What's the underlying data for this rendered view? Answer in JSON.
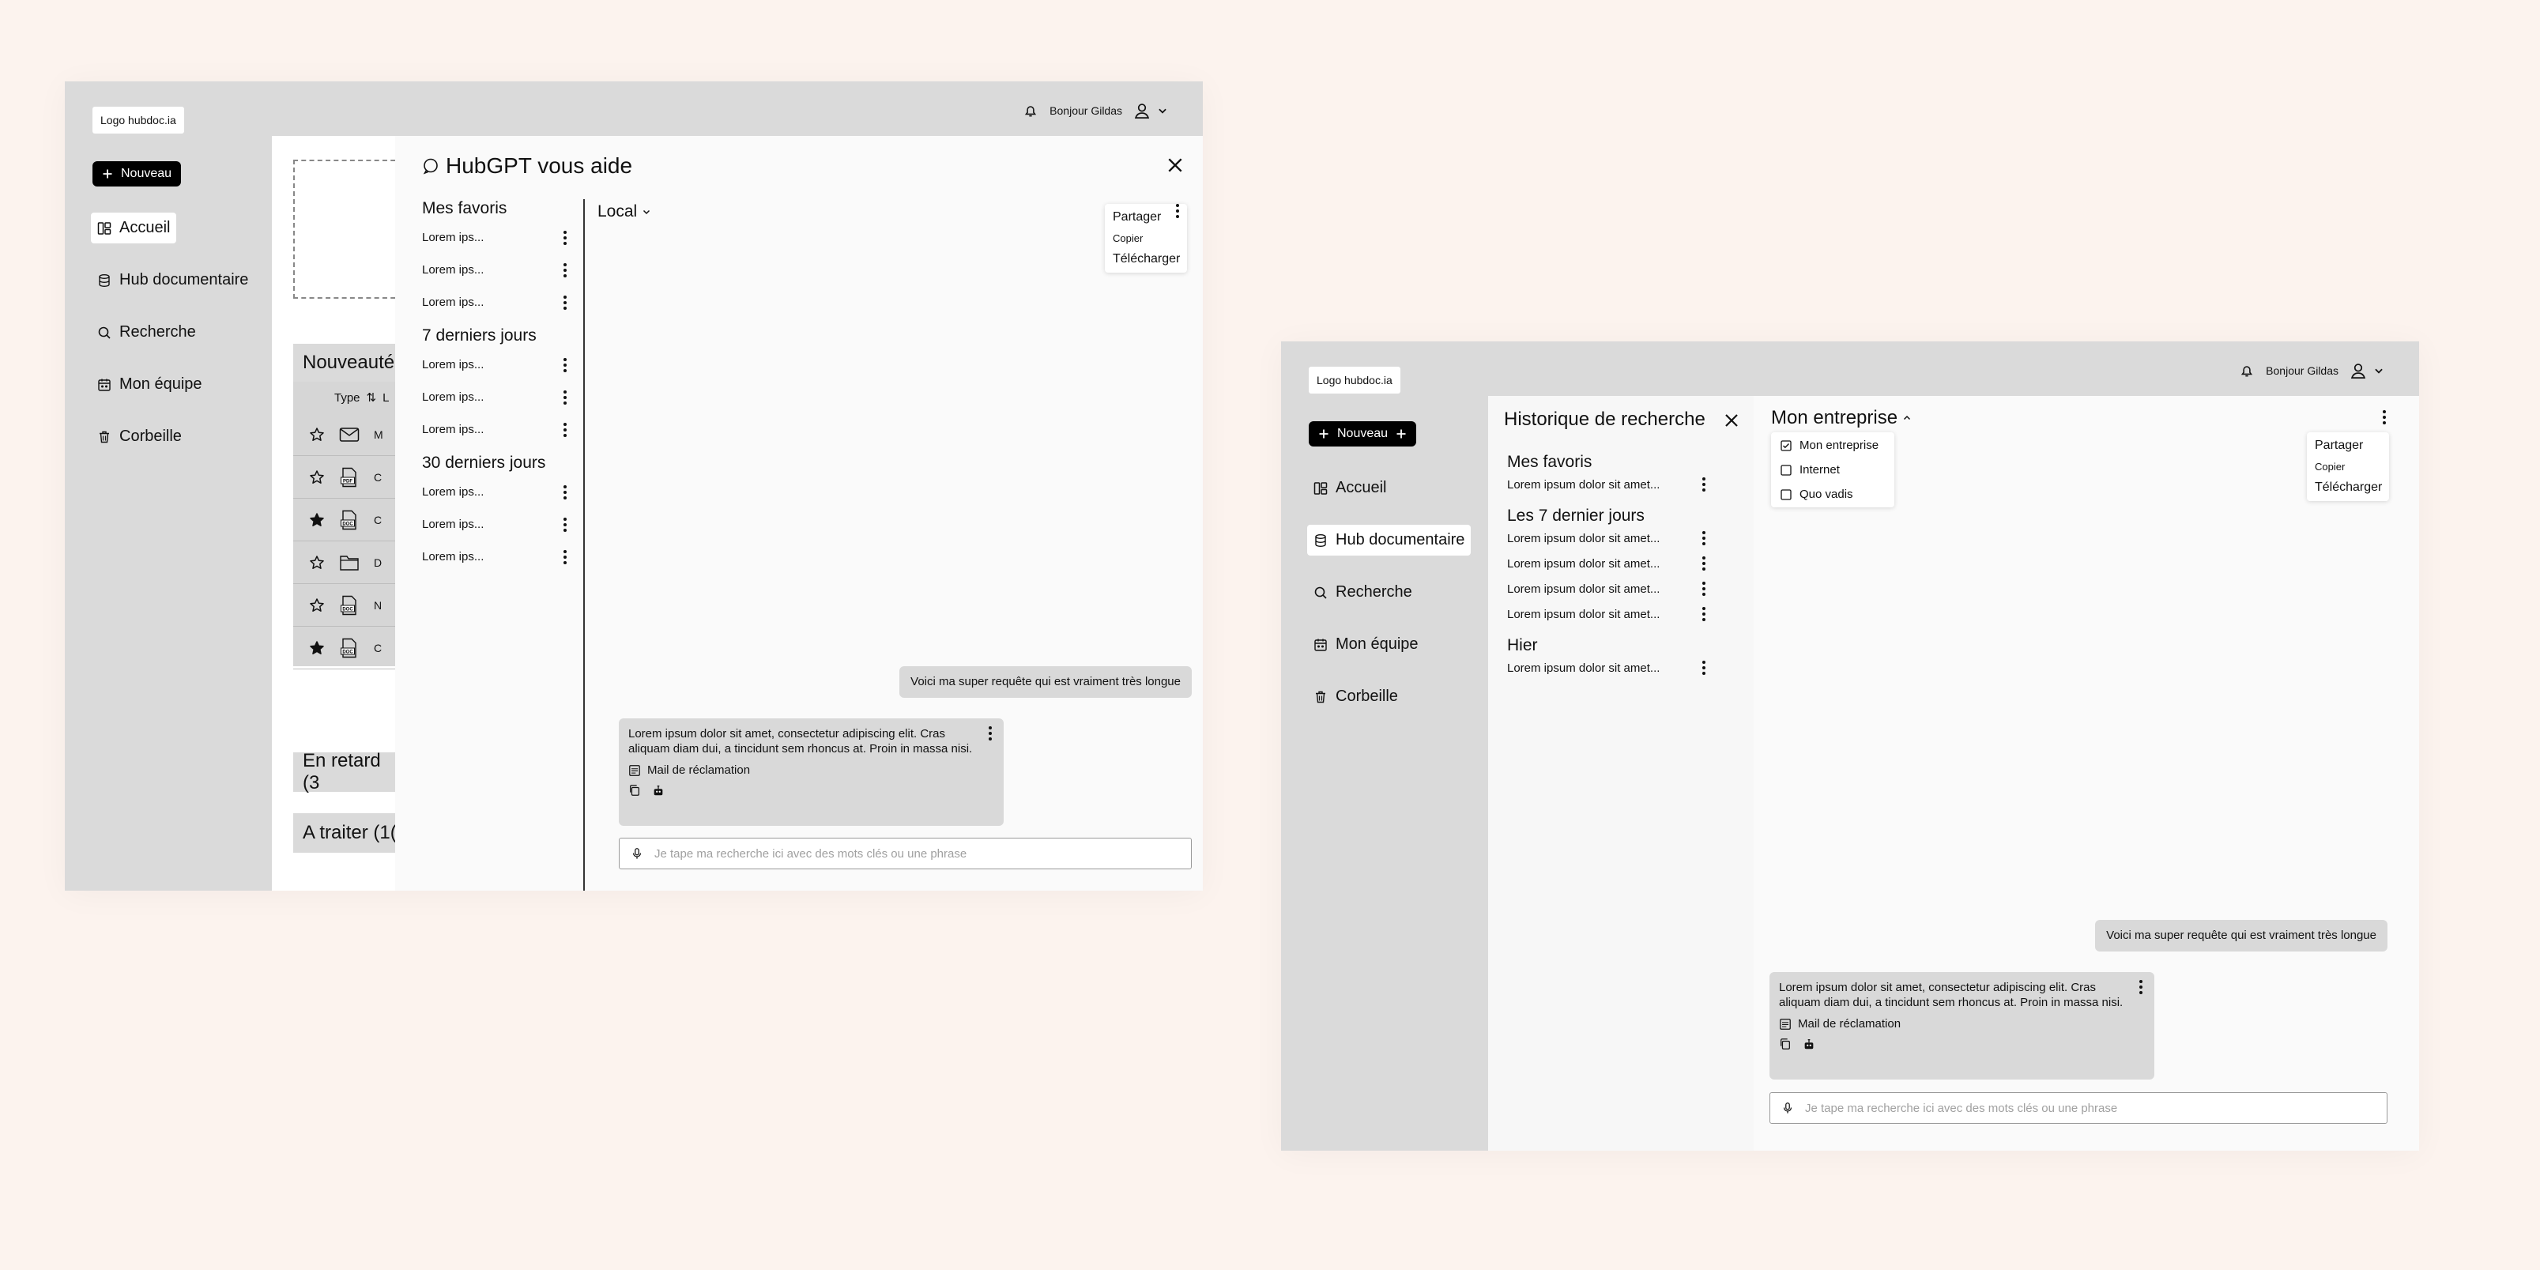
{
  "left": {
    "logo": "Logo hubdoc.ia",
    "greeting": "Bonjour Gildas",
    "new_button": "Nouveau",
    "nav": [
      "Accueil",
      "Hub documentaire",
      "Recherche",
      "Mon équipe",
      "Corbeille"
    ],
    "active_nav": "Accueil",
    "background": {
      "section_new": "Nouveauté",
      "type_col": "Type",
      "type_col_extra": "L",
      "rows": [
        {
          "starred": false,
          "icon": "mail-icon",
          "trail": "M"
        },
        {
          "starred": false,
          "icon": "pdf-icon",
          "trail": "C"
        },
        {
          "starred": true,
          "icon": "doc-icon",
          "trail": "C"
        },
        {
          "starred": false,
          "icon": "file-icon",
          "trail": "D"
        },
        {
          "starred": false,
          "icon": "doc-icon",
          "trail": "N"
        },
        {
          "starred": true,
          "icon": "doc-icon",
          "trail": "C"
        }
      ],
      "section_late": "En retard (3",
      "section_todo": "A traiter (1("
    },
    "panel_title": "HubGPT vous aide",
    "groups": [
      {
        "title": "Mes favoris",
        "items": [
          "Lorem ips...",
          "Lorem ips...",
          "Lorem ips..."
        ]
      },
      {
        "title": "7 derniers jours",
        "items": [
          "Lorem ips...",
          "Lorem ips...",
          "Lorem ips..."
        ]
      },
      {
        "title": "30 derniers jours",
        "items": [
          "Lorem ips...",
          "Lorem ips...",
          "Lorem ips..."
        ]
      }
    ],
    "scope": "Local",
    "menu": [
      "Partager",
      "Copier",
      "Télécharger"
    ],
    "user_message": "Voici ma super requête qui est vraiment très longue",
    "ai_message": "Lorem ipsum dolor sit amet, consectetur adipiscing elit. Cras aliquam diam dui, a tincidunt sem rhoncus at. Proin in massa nisi.",
    "attachment": "Mail de réclamation",
    "search_placeholder": "Je tape ma recherche ici avec des mots clés ou une phrase"
  },
  "right": {
    "logo": "Logo hubdoc.ia",
    "greeting": "Bonjour Gildas",
    "new_button": "Nouveau",
    "nav": [
      "Accueil",
      "Hub documentaire",
      "Recherche",
      "Mon équipe",
      "Corbeille"
    ],
    "active_nav": "Hub documentaire",
    "history_title": "Historique de recherche",
    "groups": [
      {
        "title": "Mes favoris",
        "items": [
          "Lorem ipsum dolor sit amet..."
        ]
      },
      {
        "title": "Les 7 dernier jours",
        "items": [
          "Lorem ipsum dolor sit amet...",
          "Lorem ipsum dolor sit amet...",
          "Lorem ipsum dolor sit amet...",
          "Lorem ipsum dolor sit amet..."
        ]
      },
      {
        "title": "Hier",
        "items": [
          "Lorem ipsum dolor sit amet..."
        ]
      }
    ],
    "scope": "Mon entreprise",
    "scope_options": [
      {
        "label": "Mon entreprise",
        "checked": true
      },
      {
        "label": "Internet",
        "checked": false
      },
      {
        "label": "Quo vadis",
        "checked": false
      }
    ],
    "menu": [
      "Partager",
      "Copier",
      "Télécharger"
    ],
    "user_message": "Voici ma super requête qui est vraiment très longue",
    "ai_message": "Lorem ipsum dolor sit amet, consectetur adipiscing elit. Cras aliquam diam dui, a tincidunt sem rhoncus at. Proin in massa nisi.",
    "attachment": "Mail de réclamation",
    "search_placeholder": "Je tape ma recherche ici avec des mots clés ou une phrase"
  }
}
